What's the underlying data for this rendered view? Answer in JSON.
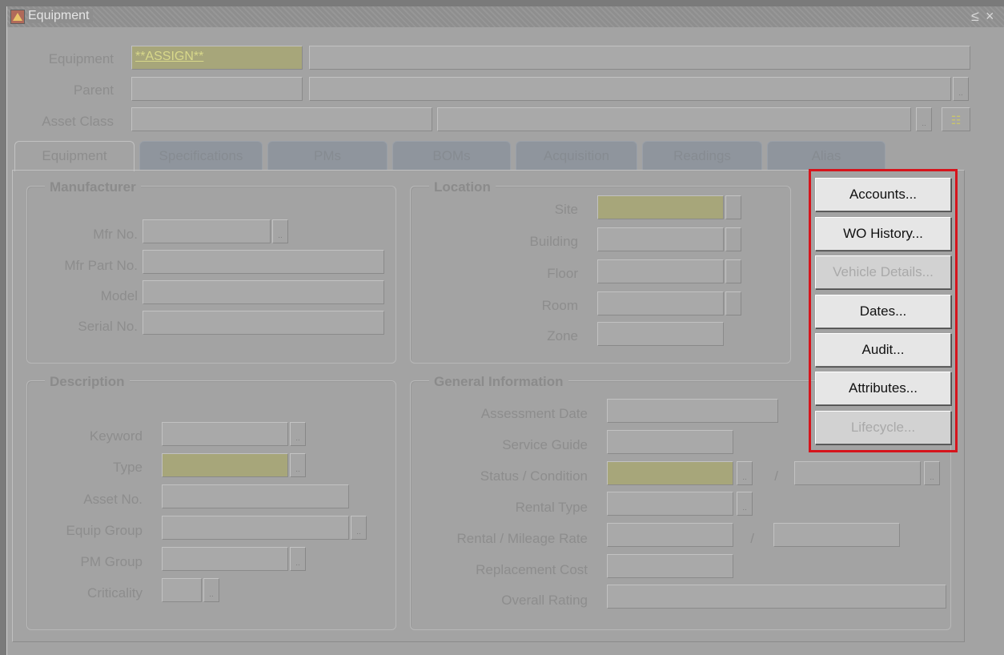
{
  "window": {
    "title": "Equipment",
    "controls": [
      "≤",
      "×"
    ]
  },
  "header": {
    "equipment_label": "Equipment",
    "equipment_value": "**ASSIGN**",
    "parent_label": "Parent",
    "asset_class_label": "Asset Class"
  },
  "tabs": [
    "Equipment",
    "Specifications",
    "PMs",
    "BOMs",
    "Acquisition",
    "Readings",
    "Alias"
  ],
  "manufacturer": {
    "title": "Manufacturer",
    "mfr_no": "Mfr No.",
    "mfr_part_no": "Mfr Part No.",
    "model": "Model",
    "serial_no": "Serial No."
  },
  "location": {
    "title": "Location",
    "site": "Site",
    "building": "Building",
    "floor": "Floor",
    "room": "Room",
    "zone": "Zone"
  },
  "description": {
    "title": "Description",
    "keyword": "Keyword",
    "type": "Type",
    "asset_no": "Asset No.",
    "equip_group": "Equip Group",
    "pm_group": "PM Group",
    "criticality": "Criticality"
  },
  "general": {
    "title": "General Information",
    "assessment_date": "Assessment Date",
    "service_guide": "Service Guide",
    "status_condition": "Status / Condition",
    "rental_type": "Rental Type",
    "rental_mileage_rate": "Rental / Mileage Rate",
    "replacement_cost": "Replacement Cost",
    "overall_rating": "Overall Rating",
    "slash": "/"
  },
  "actions": {
    "accounts": "Accounts...",
    "wo_history": "WO History...",
    "vehicle_details": "Vehicle Details...",
    "dates": "Dates...",
    "audit": "Audit...",
    "attributes": "Attributes...",
    "lifecycle": "Lifecycle..."
  },
  "colors": {
    "highlight": "#d6141c",
    "required_field": "#a7a67a"
  }
}
